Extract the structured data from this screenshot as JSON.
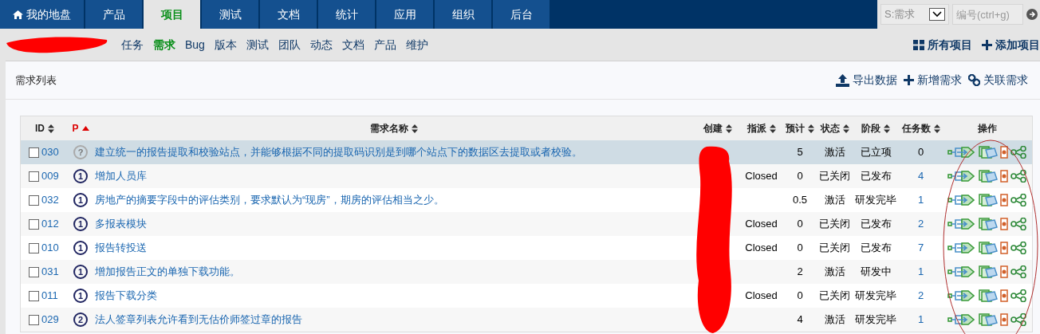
{
  "main_nav": [
    {
      "label": "我的地盘",
      "kind": "home",
      "selected": false
    },
    {
      "label": "产品",
      "kind": "tab",
      "selected": false
    },
    {
      "label": "项目",
      "kind": "tab",
      "selected": true
    },
    {
      "label": "测试",
      "kind": "tab",
      "selected": false
    },
    {
      "label": "文档",
      "kind": "tab",
      "selected": false
    },
    {
      "label": "统计",
      "kind": "tab",
      "selected": false
    },
    {
      "label": "应用",
      "kind": "tab",
      "selected": false
    },
    {
      "label": "组织",
      "kind": "tab",
      "selected": false
    },
    {
      "label": "后台",
      "kind": "tab",
      "selected": false
    }
  ],
  "search": {
    "type_select": "S:需求",
    "placeholder": "编号(ctrl+g)"
  },
  "sub_nav": [
    {
      "label": "任务",
      "selected": false
    },
    {
      "label": "需求",
      "selected": true
    },
    {
      "label": "Bug",
      "selected": false
    },
    {
      "label": "版本",
      "selected": false
    },
    {
      "label": "测试",
      "selected": false
    },
    {
      "label": "团队",
      "selected": false
    },
    {
      "label": "动态",
      "selected": false
    },
    {
      "label": "文档",
      "selected": false
    },
    {
      "label": "产品",
      "selected": false
    },
    {
      "label": "维护",
      "selected": false
    }
  ],
  "sub_nav_actions": [
    {
      "label": "所有项目",
      "kind": "grid"
    },
    {
      "label": "添加项目",
      "kind": "plus"
    }
  ],
  "panel": {
    "title": "需求列表",
    "actions": [
      {
        "label": "导出数据",
        "kind": "upload"
      },
      {
        "label": "新增需求",
        "kind": "plus"
      },
      {
        "label": "关联需求",
        "kind": "link"
      }
    ]
  },
  "table": {
    "columns": [
      {
        "label": "ID",
        "sortable": true,
        "sorted": false
      },
      {
        "label": "P",
        "sortable": true,
        "sorted": true
      },
      {
        "label": "需求名称",
        "sortable": true,
        "sorted": false
      },
      {
        "label": "创建",
        "sortable": true,
        "sorted": false
      },
      {
        "label": "指派",
        "sortable": true,
        "sorted": false
      },
      {
        "label": "预计",
        "sortable": true,
        "sorted": false
      },
      {
        "label": "状态",
        "sortable": true,
        "sorted": false
      },
      {
        "label": "阶段",
        "sortable": true,
        "sorted": false
      },
      {
        "label": "任务数",
        "sortable": true,
        "sorted": false
      },
      {
        "label": "操作",
        "sortable": false,
        "sorted": false
      }
    ],
    "rows": [
      {
        "id": "030",
        "checked": false,
        "selected": true,
        "priority": {
          "kind": "none",
          "label": "?"
        },
        "name": "建立统一的报告提取和校验站点，并能够根据不同的提取码识别是到哪个站点下的数据区去提取或者校验。",
        "assigned": "",
        "estimate": "5",
        "status": "激活",
        "stage": "已立项",
        "tasks": "0"
      },
      {
        "id": "009",
        "checked": false,
        "selected": false,
        "priority": {
          "kind": "level",
          "label": "1"
        },
        "name": "增加人员库",
        "assigned": "Closed",
        "estimate": "0",
        "status": "已关闭",
        "stage": "已发布",
        "tasks": "4"
      },
      {
        "id": "032",
        "checked": false,
        "selected": false,
        "priority": {
          "kind": "level",
          "label": "1"
        },
        "name": "房地产的摘要字段中的评估类别，要求默认为“现房”，期房的评估相当之少。",
        "assigned": "",
        "estimate": "0.5",
        "status": "激活",
        "stage": "研发完毕",
        "tasks": "1"
      },
      {
        "id": "012",
        "checked": false,
        "selected": false,
        "priority": {
          "kind": "level",
          "label": "1"
        },
        "name": "多报表模块",
        "assigned": "Closed",
        "estimate": "0",
        "status": "已关闭",
        "stage": "已发布",
        "tasks": "2"
      },
      {
        "id": "010",
        "checked": false,
        "selected": false,
        "priority": {
          "kind": "level",
          "label": "1"
        },
        "name": "报告转投送",
        "assigned": "Closed",
        "estimate": "0",
        "status": "已关闭",
        "stage": "已发布",
        "tasks": "7"
      },
      {
        "id": "031",
        "checked": false,
        "selected": false,
        "priority": {
          "kind": "level",
          "label": "1"
        },
        "name": "增加报告正文的单独下载功能。",
        "assigned": "",
        "estimate": "2",
        "status": "激活",
        "stage": "研发中",
        "tasks": "1"
      },
      {
        "id": "011",
        "checked": false,
        "selected": false,
        "priority": {
          "kind": "level",
          "label": "1"
        },
        "name": "报告下载分类",
        "assigned": "Closed",
        "estimate": "0",
        "status": "已关闭",
        "stage": "研发完毕",
        "tasks": "2"
      },
      {
        "id": "029",
        "checked": false,
        "selected": false,
        "priority": {
          "kind": "level",
          "label": "2"
        },
        "name": "法人签章列表允许看到无估价师签过章的报告",
        "assigned": "",
        "estimate": "4",
        "status": "激活",
        "stage": "研发完毕",
        "tasks": "1"
      }
    ]
  }
}
